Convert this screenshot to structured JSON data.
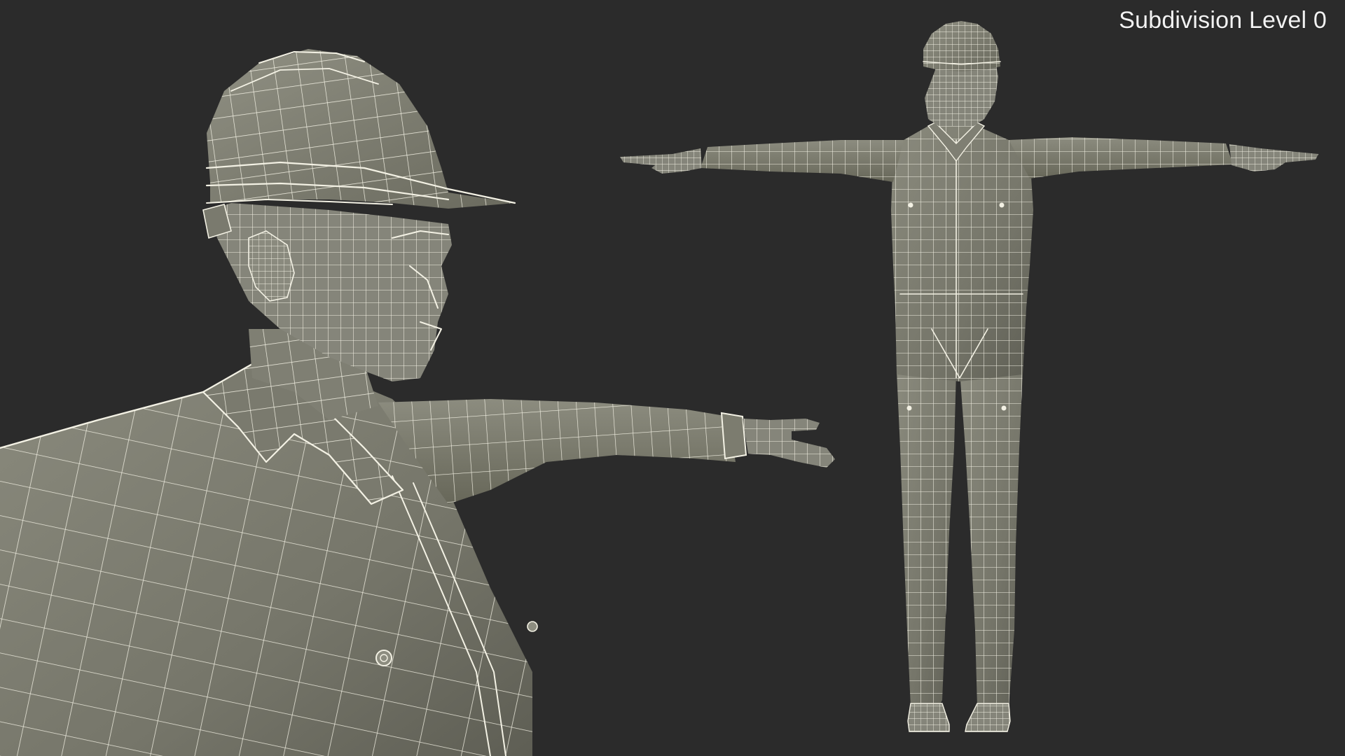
{
  "viewport_label": "Subdivision Level 0",
  "colors": {
    "background": "#2b2b2b",
    "mesh_fill": "#7c7c6f",
    "mesh_shade": "#5d5d53",
    "wire": "#f3f1e4",
    "label": "#f2f2f2"
  },
  "views": [
    {
      "name": "closeup-view",
      "subject": "construction worker with hard hat, T-pose, upper body wireframe"
    },
    {
      "name": "full-body-view",
      "subject": "construction worker with hard hat, T-pose, full body wireframe"
    }
  ]
}
